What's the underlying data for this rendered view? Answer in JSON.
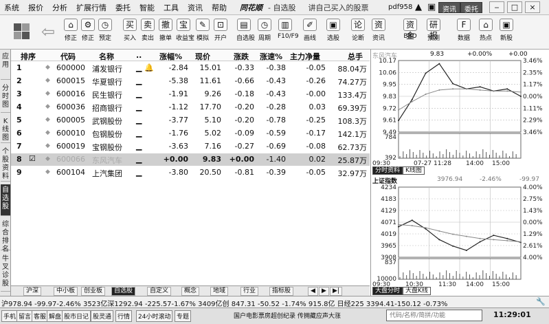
{
  "menubar": {
    "items": [
      "系统",
      "报价",
      "分析",
      "扩展行情",
      "委托",
      "智能",
      "工具",
      "资讯",
      "帮助"
    ],
    "app_logo": "同花顺",
    "app_sub": "- 自选股",
    "slogan": "讲自己买入的股票",
    "username": "pdf958",
    "btn_info": "资讯",
    "btn_trade": "委托",
    "win_min": "‒",
    "win_max": "□",
    "win_close": "×"
  },
  "toolbar": {
    "buttons": [
      {
        "icon": "⌂",
        "label": "修正"
      },
      {
        "icon": "⚙",
        "label": "修正"
      },
      {
        "icon": "◷",
        "label": "预定"
      },
      {
        "icon": "买",
        "label": "买入"
      },
      {
        "icon": "卖",
        "label": "卖出"
      },
      {
        "icon": "撤",
        "label": "撤单"
      },
      {
        "icon": "宝",
        "label": "收益宝"
      },
      {
        "icon": "✎",
        "label": "模拟"
      },
      {
        "icon": "⊡",
        "label": "开户"
      },
      {
        "icon": "▤",
        "label": "自选股"
      },
      {
        "icon": "◷",
        "label": "周期"
      },
      {
        "icon": "▥",
        "label": "F10/F9"
      },
      {
        "icon": "✐",
        "label": "画线"
      },
      {
        "icon": "▣",
        "label": "选股"
      },
      {
        "icon": "论",
        "label": "论断"
      },
      {
        "icon": "资",
        "label": "资讯"
      },
      {
        "icon": "资金",
        "label": "BBD"
      },
      {
        "icon": "研报",
        "label": "预测"
      },
      {
        "icon": "F",
        "label": "数据"
      },
      {
        "icon": "⌂",
        "label": "热点"
      },
      {
        "icon": "▣",
        "label": "新股"
      }
    ]
  },
  "left_tabs": [
    {
      "label": "应用",
      "active": false
    },
    {
      "label": "分时图",
      "active": false
    },
    {
      "label": "K线图",
      "active": false
    },
    {
      "label": "个股资料",
      "active": false
    },
    {
      "label": "自选股",
      "active": true
    },
    {
      "label": "综合排名",
      "active": false
    },
    {
      "label": "牛叉诊股",
      "active": false
    }
  ],
  "quote_table": {
    "columns": [
      "排序",
      "代码",
      "名称",
      "..",
      "涨幅%",
      "现价",
      "涨跌",
      "涨速%",
      "主力净量",
      "总手"
    ],
    "rows": [
      {
        "idx": "1",
        "code": "600000",
        "name": "浦发银行",
        "flag": "▁ 🔔",
        "chg_pct": "-2.84",
        "price": "15.01",
        "chg": "-0.33",
        "speed": "-0.38",
        "net": "-0.05",
        "vol": "88.04万",
        "selected": false
      },
      {
        "idx": "2",
        "code": "600015",
        "name": "华夏银行",
        "flag": "▁",
        "chg_pct": "-5.38",
        "price": "11.61",
        "chg": "-0.66",
        "speed": "-0.43",
        "net": "-0.26",
        "vol": "74.27万",
        "selected": false
      },
      {
        "idx": "3",
        "code": "600016",
        "name": "民生银行",
        "flag": "▁",
        "chg_pct": "-1.91",
        "price": "9.26",
        "chg": "-0.18",
        "speed": "-0.43",
        "net": "-0.00",
        "vol": "133.4万",
        "selected": false
      },
      {
        "idx": "4",
        "code": "600036",
        "name": "招商银行",
        "flag": "▁",
        "chg_pct": "-1.12",
        "price": "17.70",
        "chg": "-0.20",
        "speed": "-0.28",
        "net": "0.03",
        "vol": "69.39万",
        "selected": false
      },
      {
        "idx": "5",
        "code": "600005",
        "name": "武钢股份",
        "flag": "▁",
        "chg_pct": "-3.77",
        "price": "5.10",
        "chg": "-0.20",
        "speed": "-0.78",
        "net": "-0.25",
        "vol": "108.3万",
        "selected": false
      },
      {
        "idx": "6",
        "code": "600010",
        "name": "包钢股份",
        "flag": "▁",
        "chg_pct": "-1.76",
        "price": "5.02",
        "chg": "-0.09",
        "speed": "-0.59",
        "net": "-0.17",
        "vol": "142.1万",
        "selected": false
      },
      {
        "idx": "7",
        "code": "600019",
        "name": "宝钢股份",
        "flag": "▁",
        "chg_pct": "-3.63",
        "price": "7.16",
        "chg": "-0.27",
        "speed": "-0.69",
        "net": "-0.08",
        "vol": "62.73万",
        "selected": false
      },
      {
        "idx": "8",
        "code": "600066",
        "name": "东风汽车",
        "flag": "▁",
        "chg_pct": "+0.00",
        "price": "9.83",
        "chg": "+0.00",
        "speed": "-1.40",
        "net": "0.02",
        "vol": "25.87万",
        "selected": true
      },
      {
        "idx": "9",
        "code": "600104",
        "name": "上汽集团",
        "flag": "▁",
        "chg_pct": "-3.80",
        "price": "20.50",
        "chg": "-0.81",
        "speed": "-0.39",
        "net": "-0.05",
        "vol": "32.97万",
        "selected": false
      }
    ]
  },
  "sheet_tabs": [
    {
      "label": "沪深",
      "active": false
    },
    {
      "label": "中小板",
      "active": false
    },
    {
      "label": "创业板",
      "active": false
    },
    {
      "label": "自选股",
      "active": true
    },
    {
      "label": "自定义",
      "active": false
    },
    {
      "label": "概念",
      "active": false
    },
    {
      "label": "地域",
      "active": false
    },
    {
      "label": "行业",
      "active": false
    },
    {
      "label": "指标股",
      "active": false
    }
  ],
  "stock_chart": {
    "name": "东风汽车",
    "price": "9.83",
    "chg": "+0.00%",
    "vol_label": "+0.00",
    "y_left": [
      "10.17",
      "10.06",
      "9.95",
      "9.83",
      "9.72",
      "9.61",
      "9.49",
      "784",
      "392"
    ],
    "y_right": [
      "3.46%",
      "2.35%",
      "1.17%",
      "0.00%",
      "1.11%",
      "2.29%",
      "3.46%"
    ],
    "x_labels": [
      "09:30",
      "07-27 11:28",
      "14:00",
      "15:00"
    ],
    "tabs": [
      {
        "label": "分时资料",
        "active": true
      },
      {
        "label": "K线图",
        "active": false
      }
    ],
    "chart_data": {
      "type": "line",
      "title": "东风汽车",
      "x": [
        "09:30",
        "10:00",
        "10:30",
        "11:00",
        "11:30",
        "13:00",
        "13:30",
        "14:00",
        "14:30",
        "15:00"
      ],
      "series": [
        {
          "name": "price",
          "values": [
            9.6,
            9.8,
            10.05,
            10.14,
            9.95,
            9.9,
            9.92,
            9.88,
            9.9,
            9.83
          ]
        },
        {
          "name": "avg",
          "values": [
            9.7,
            9.78,
            9.85,
            9.89,
            9.9,
            9.9,
            9.89,
            9.88,
            9.88,
            9.87
          ]
        }
      ],
      "ylim": [
        9.49,
        10.17
      ]
    }
  },
  "index_chart": {
    "name": "上证指数",
    "value": "3976.94",
    "chg": "-2.46%",
    "chg_pts": "-99.97",
    "y_left": [
      "4234",
      "4183",
      "4129",
      "4071",
      "4019",
      "3965",
      "3908",
      "837",
      "10000"
    ],
    "y_right": [
      "4.00%",
      "2.75%",
      "1.43%",
      "0.00%",
      "1.29%",
      "2.61%",
      "4.00%"
    ],
    "x_labels": [
      "09:30",
      "10:30",
      "11:30",
      "14:00",
      "15:00"
    ],
    "tabs": [
      {
        "label": "大盘分时",
        "active": true
      },
      {
        "label": "大盘K线",
        "active": false
      }
    ],
    "chart_data": {
      "type": "line",
      "title": "上证指数",
      "x": [
        "09:30",
        "10:00",
        "10:30",
        "11:00",
        "11:30",
        "13:00",
        "13:30",
        "14:00",
        "14:30",
        "15:00"
      ],
      "series": [
        {
          "name": "index",
          "values": [
            4050,
            4080,
            4040,
            3990,
            3960,
            3940,
            3980,
            4010,
            3995,
            3977
          ]
        },
        {
          "name": "avg",
          "values": [
            4060,
            4055,
            4045,
            4030,
            4015,
            4005,
            3995,
            3990,
            3985,
            3980
          ]
        }
      ],
      "ylim": [
        3908,
        4234
      ]
    }
  },
  "status": {
    "text": "沪978.94  -99.97-2.46%  3523亿深1292.94  -225.57-1.67%  3409亿创  847.31  -50.52 -1.74%  915.8亿  日经225  3394.41-150.12  -0.73%"
  },
  "footer": {
    "buttons": [
      "手机",
      "留言",
      "客服",
      "解盘",
      "股市日记",
      "股灵通",
      "行情",
      "24小时滚动",
      "专题"
    ],
    "ticker": "国户电影票房超创纪录 传拥藏应声大涨",
    "search_placeholder": "代码/名称/简拼/功能",
    "time": "11:29:01"
  },
  "colors": {
    "accent_dark": "#222222",
    "selected_row": "#cfcfcf",
    "grid": "#999999"
  }
}
